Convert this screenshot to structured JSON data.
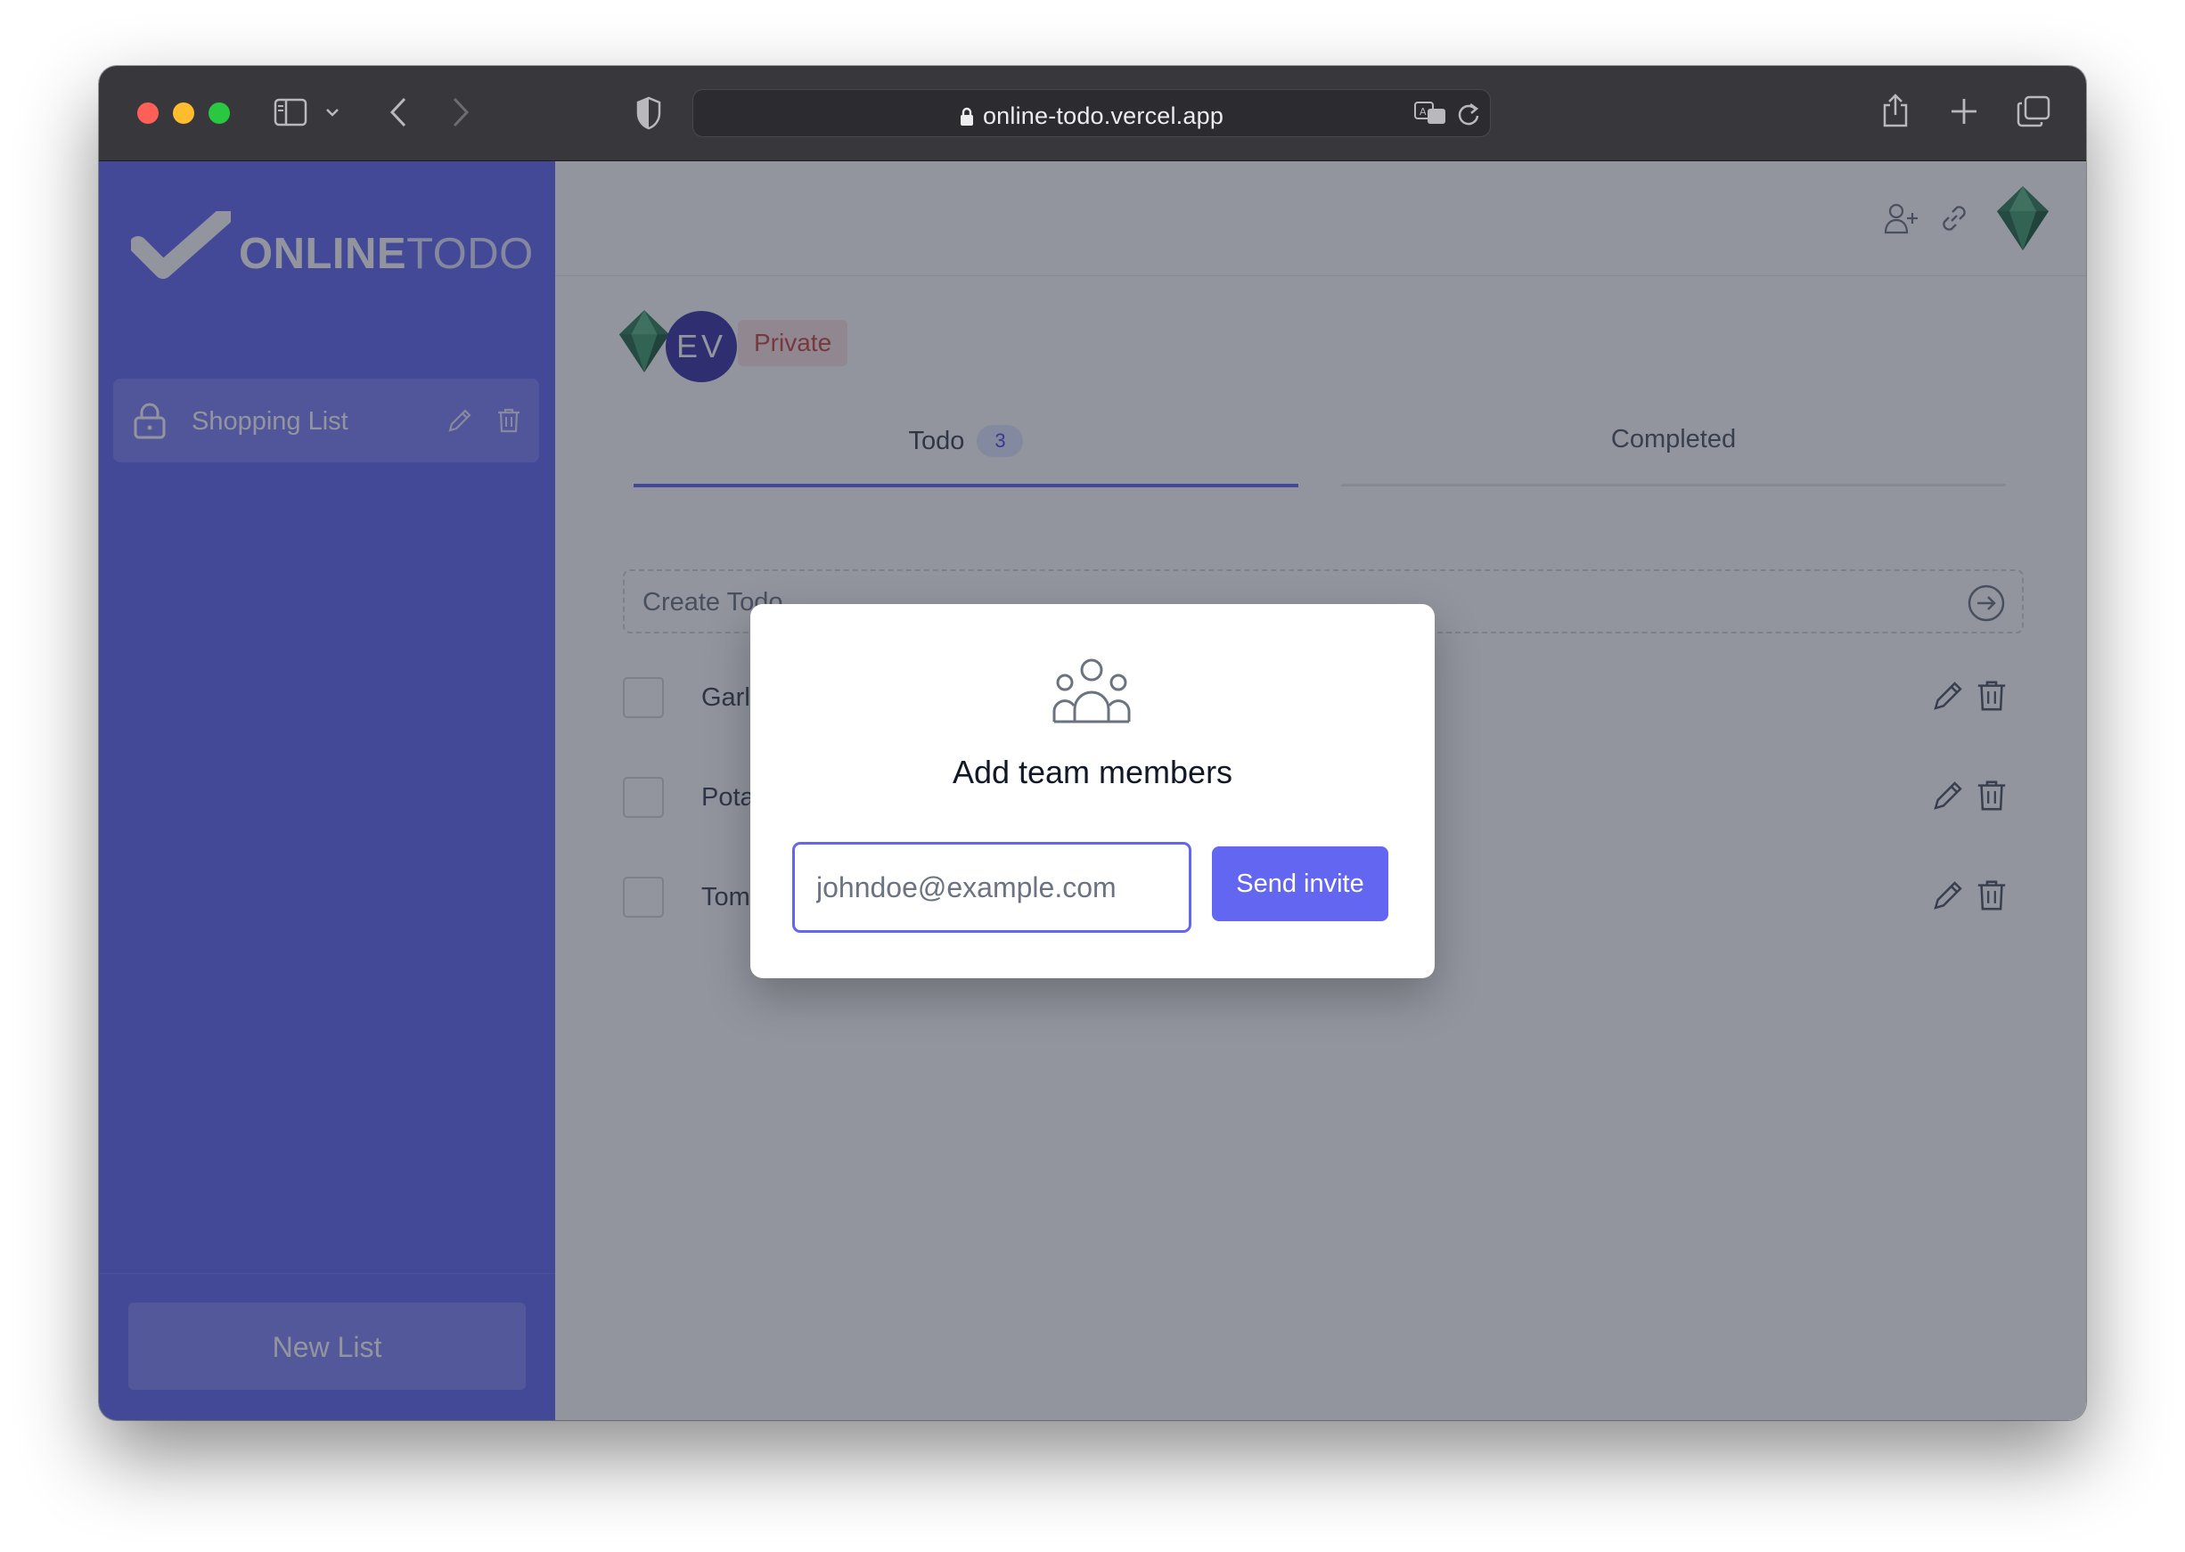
{
  "browser": {
    "url": "online-todo.vercel.app",
    "traffic_lights": {
      "close": "#fe5f57",
      "minimize": "#febc2e",
      "zoom": "#28c840"
    }
  },
  "sidebar": {
    "logo_bold": "ONLINE",
    "logo_light": "TODO",
    "lists": [
      {
        "label": "Shopping List",
        "icon": "lock-icon"
      }
    ],
    "new_list_label": "New List"
  },
  "main": {
    "avatar_initials": "EV",
    "visibility_badge": "Private",
    "tabs": [
      {
        "label": "Todo",
        "count": "3"
      },
      {
        "label": "Completed"
      }
    ],
    "create_placeholder": "Create Todo",
    "todos": [
      {
        "text": "Garlic"
      },
      {
        "text": "Potat"
      },
      {
        "text": "Toma"
      }
    ]
  },
  "modal": {
    "icon": "team-icon",
    "title": "Add team members",
    "email_placeholder": "johndoe@example.com",
    "send_label": "Send invite"
  },
  "colors": {
    "accent": "#6366f1",
    "badge_bg": "#fde2e2",
    "badge_text": "#c7463e"
  }
}
